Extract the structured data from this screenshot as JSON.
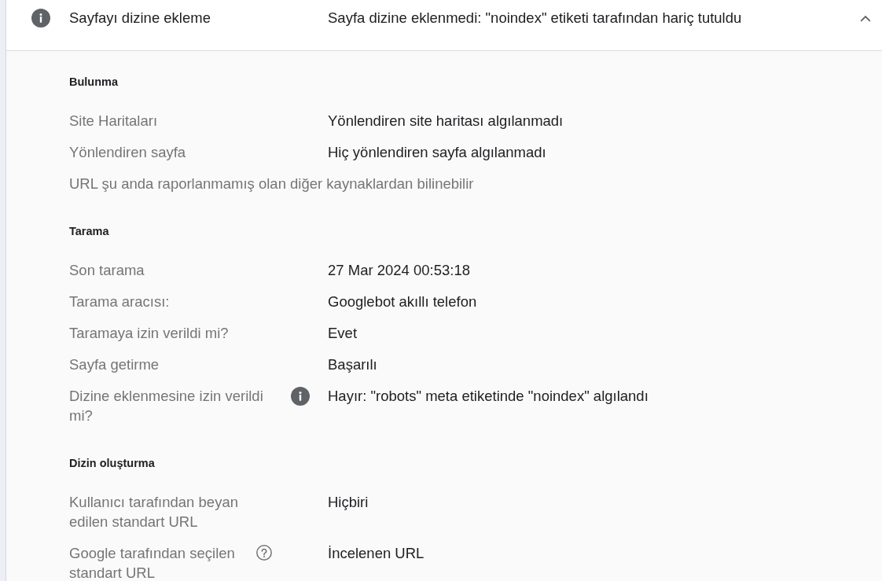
{
  "panel": {
    "title": "Sayfayı dizine ekleme",
    "status": "Sayfa dizine eklenmedi: \"noindex\" etiketi tarafından hariç tutuldu",
    "expanded": true
  },
  "sections": [
    {
      "heading": "Bulunma",
      "rows": [
        {
          "kind": "field",
          "label": "Site Haritaları",
          "value": "Yönlendiren site haritası algılanmadı"
        },
        {
          "kind": "field",
          "label": "Yönlendiren sayfa",
          "value": "Hiç yönlendiren sayfa algılanmadı"
        },
        {
          "kind": "note",
          "label": "URL şu anda raporlanmamış olan diğer kaynaklardan bilinebilir"
        }
      ]
    },
    {
      "heading": "Tarama",
      "rows": [
        {
          "kind": "field",
          "label": "Son tarama",
          "value": "27 Mar 2024 00:53:18"
        },
        {
          "kind": "field",
          "label": "Tarama aracısı:",
          "value": "Googlebot akıllı telefon"
        },
        {
          "kind": "field",
          "label": "Taramaya izin verildi mi?",
          "value": "Evet"
        },
        {
          "kind": "field",
          "label": "Sayfa getirme",
          "value": "Başarılı"
        },
        {
          "kind": "info",
          "label": "Dizine eklenmesine izin verildi mi?",
          "value": "Hayır: \"robots\" meta etiketinde \"noindex\" algılandı"
        }
      ]
    },
    {
      "heading": "Dizin oluşturma",
      "rows": [
        {
          "kind": "field",
          "label": "Kullanıcı tarafından beyan edilen standart URL",
          "value": "Hiçbiri"
        },
        {
          "kind": "help",
          "label": "Google tarafından seçilen standart URL",
          "value": "İncelenen URL"
        }
      ]
    }
  ]
}
